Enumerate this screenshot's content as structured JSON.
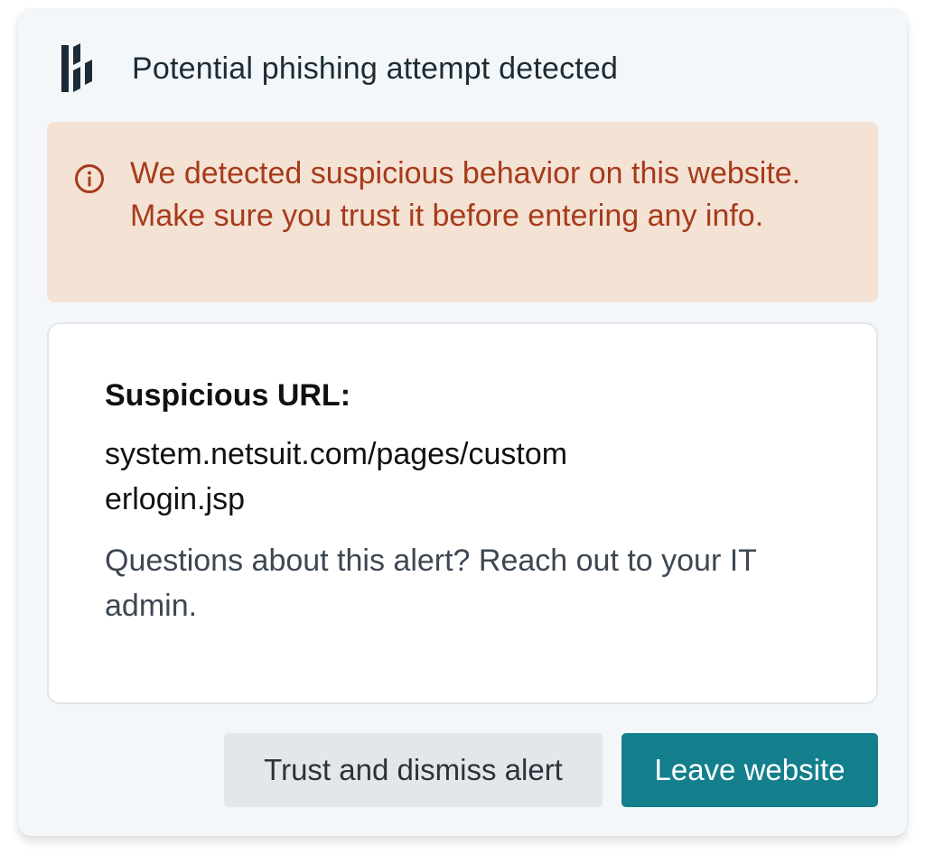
{
  "header": {
    "title": "Potential phishing attempt detected",
    "logo_icon": "dashlane-logo-icon"
  },
  "warning": {
    "icon": "info-circle-icon",
    "message": "We detected suspicious behavior on this website. Make sure you trust it before entering any info.",
    "background_color": "#f4e2d4",
    "text_color": "#a63b1b"
  },
  "details": {
    "label": "Suspicious URL:",
    "url": "system.netsuit.com/pages/customerlogin.jsp",
    "help": "Questions about this alert? Reach out to your IT admin."
  },
  "actions": {
    "trust_label": "Trust and dismiss alert",
    "leave_label": "Leave website",
    "primary_color": "#137f8d"
  }
}
